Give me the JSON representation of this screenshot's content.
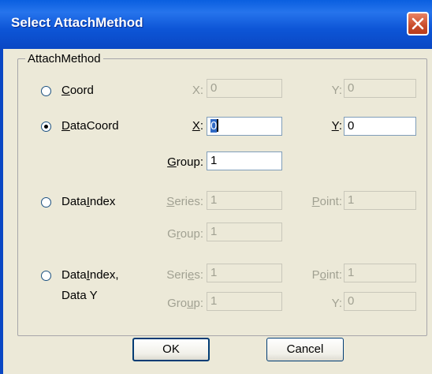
{
  "window": {
    "title": "Select AttachMethod"
  },
  "group": {
    "label": "AttachMethod"
  },
  "options": {
    "coord": {
      "label_pre": "",
      "label_ul": "C",
      "label_post": "oord",
      "selected": false
    },
    "datacoord": {
      "label_pre": "",
      "label_ul": "D",
      "label_post": "ataCoord",
      "selected": true
    },
    "dataindex": {
      "label_pre": "Data",
      "label_ul": "I",
      "label_post": "ndex",
      "selected": false
    },
    "dataindex_datay": {
      "label_pre": "Data",
      "label_ul": "I",
      "label_post": "ndex,",
      "line2": "Data Y",
      "selected": false
    }
  },
  "fields": {
    "coord_x": {
      "label": "X:",
      "value": "0",
      "enabled": false
    },
    "coord_y": {
      "label": "Y:",
      "value": "0",
      "enabled": false
    },
    "datacoord_x": {
      "label_ul": "X",
      "label_post": ":",
      "value": "0",
      "enabled": true
    },
    "datacoord_y": {
      "label_ul": "Y",
      "label_post": ":",
      "value": "0",
      "enabled": true
    },
    "datacoord_group": {
      "label_ul": "G",
      "label_post": "roup:",
      "value": "1",
      "enabled": true
    },
    "dataindex_series": {
      "label_pre": "",
      "label_ul": "S",
      "label_post": "eries:",
      "value": "1",
      "enabled": false
    },
    "dataindex_point": {
      "label_pre": "",
      "label_ul": "P",
      "label_post": "oint:",
      "value": "1",
      "enabled": false
    },
    "dataindex_group": {
      "label_pre": "G",
      "label_ul": "r",
      "label_post": "oup:",
      "value": "1",
      "enabled": false
    },
    "dataindexy_series": {
      "label_pre": "Seri",
      "label_ul": "e",
      "label_post": "s:",
      "value": "1",
      "enabled": false
    },
    "dataindexy_point": {
      "label_pre": "P",
      "label_ul": "o",
      "label_post": "int:",
      "value": "1",
      "enabled": false
    },
    "dataindexy_group": {
      "label_pre": "Gro",
      "label_ul": "u",
      "label_post": "p:",
      "value": "1",
      "enabled": false
    },
    "dataindexy_y": {
      "label": "Y:",
      "value": "0",
      "enabled": false
    }
  },
  "buttons": {
    "ok": "OK",
    "cancel": "Cancel"
  },
  "colors": {
    "titlebar": "#0a5fe0",
    "dialog_bg": "#ece9d8",
    "disabled_text": "#a1a192",
    "close": "#c94c2a"
  },
  "icons": {
    "close": "close-icon"
  }
}
